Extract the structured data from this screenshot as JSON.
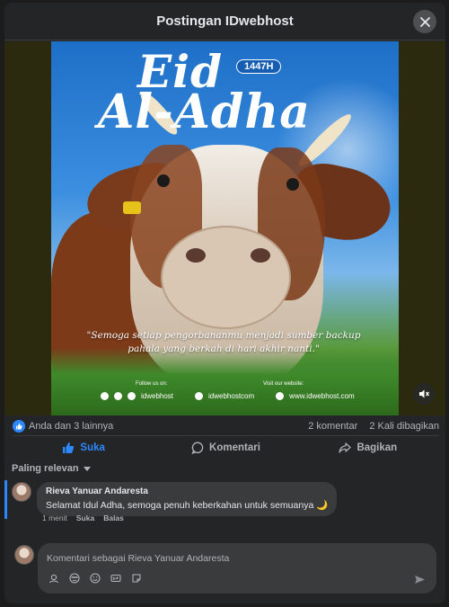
{
  "dialog": {
    "title": "Postingan IDwebhost"
  },
  "poster": {
    "headline_1": "Eid",
    "headline_2": "Al-Adha",
    "year_badge": "1447H",
    "quote": "\"Semoga setiap pengorbananmu menjadi sumber backup pahala yang berkah di hari akhir nanti.\"",
    "follow_label": "Follow us on:",
    "visit_label": "Visit our website:",
    "handle_1": "idwebhost",
    "handle_2": "idwebhostcom",
    "website": "www.idwebhost.com"
  },
  "stats": {
    "reactions_text": "Anda dan 3 lainnya",
    "comments_count": "2 komentar",
    "shares_count": "2 Kali dibagikan"
  },
  "actions": {
    "like": "Suka",
    "comment": "Komentari",
    "share": "Bagikan"
  },
  "sort": {
    "label": "Paling relevan"
  },
  "comment": {
    "author": "Rieva Yanuar Andaresta",
    "text": "Selamat Idul Adha, semoga penuh keberkahan untuk semuanya 🌙",
    "time": "1 menit",
    "like": "Suka",
    "reply": "Balas"
  },
  "composer": {
    "placeholder": "Komentari sebagai Rieva Yanuar Andaresta"
  },
  "colors": {
    "accent": "#2d88ff",
    "surface": "#242526",
    "bubble": "#3a3b3c"
  }
}
